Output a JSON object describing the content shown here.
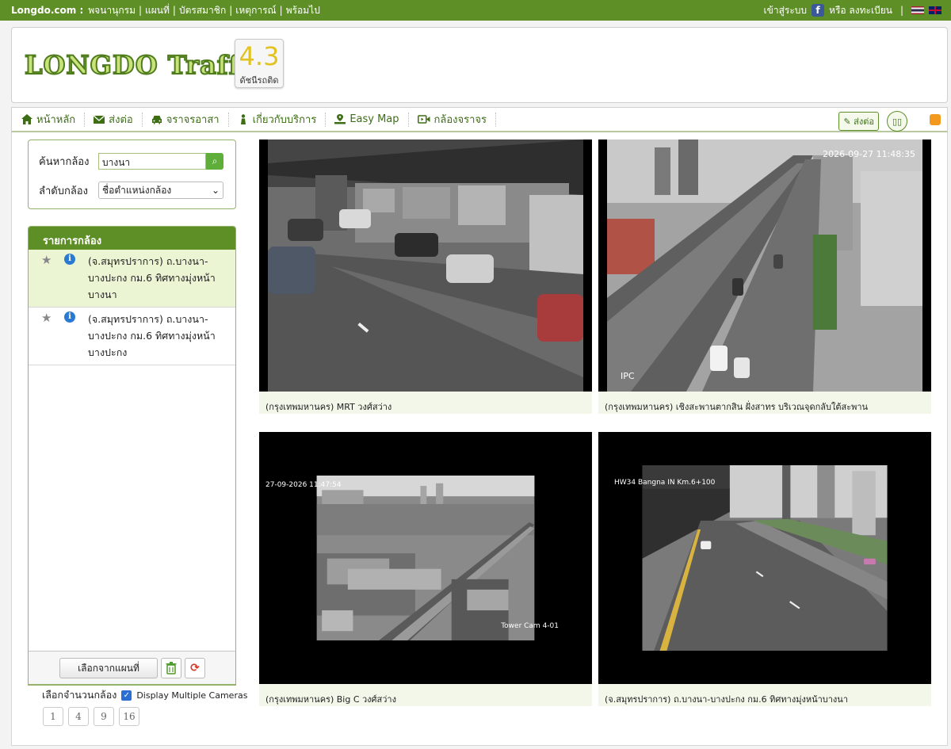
{
  "topbar": {
    "brand": "Longdo.com :",
    "links": [
      "พจนานุกรม",
      "แผนที่",
      "บัตรสมาชิก",
      "เหตุการณ์",
      "พร้อมไป"
    ],
    "login": "เข้าสู่ระบบ",
    "register": "หรือ ลงทะเบียน"
  },
  "header": {
    "logo": "LONGDO Traffic",
    "index_value": "4.3",
    "index_label": "ดัชนีรถติด"
  },
  "nav": {
    "items": [
      "หน้าหลัก",
      "ส่งต่อ",
      "จราจรอาสา",
      "เกี่ยวกับบริการ",
      "Easy Map",
      "กล้องจราจร"
    ],
    "share": "ส่งต่อ"
  },
  "search": {
    "label": "ค้นหากล้อง",
    "value": "บางนา",
    "sort_label": "ลำดับกล้อง",
    "sort_value": "ชื่อตำแหน่งกล้อง"
  },
  "list": {
    "title": "รายการกล้อง",
    "items": [
      {
        "text": "(จ.สมุทรปราการ) ถ.บางนา-บางปะกง กม.6 ทิศทางมุ่งหน้าบางนา"
      },
      {
        "text": "(จ.สมุทรปราการ) ถ.บางนา-บางปะกง กม.6 ทิศทางมุ่งหน้าบางปะกง"
      }
    ],
    "select_map": "เลือกจากแผนที่"
  },
  "multi": {
    "label": "เลือกจำนวนกล้อง",
    "checkbox_label": "Display Multiple Cameras",
    "pages": [
      "1",
      "4",
      "9",
      "16"
    ]
  },
  "cameras": [
    {
      "caption": "(กรุงเทพมหานคร) MRT วงศ์สว่าง",
      "overlay": ""
    },
    {
      "caption": "(กรุงเทพมหานคร) เชิงสะพานตากสิน ฝั่งสาทร บริเวณจุดกลับใต้สะพาน",
      "overlay": "2026-09-27 11:48:35",
      "overlay2": "IPC"
    },
    {
      "caption": "(กรุงเทพมหานคร) Big C วงศ์สว่าง",
      "overlay": "27-09-2026 11:47:54",
      "overlay2": "Tower Cam 4-01"
    },
    {
      "caption": "(จ.สมุทรปราการ) ถ.บางนา-บางปะกง กม.6 ทิศทางมุ่งหน้าบางนา",
      "overlay": "HW34 Bangna IN Km.6+100"
    }
  ]
}
